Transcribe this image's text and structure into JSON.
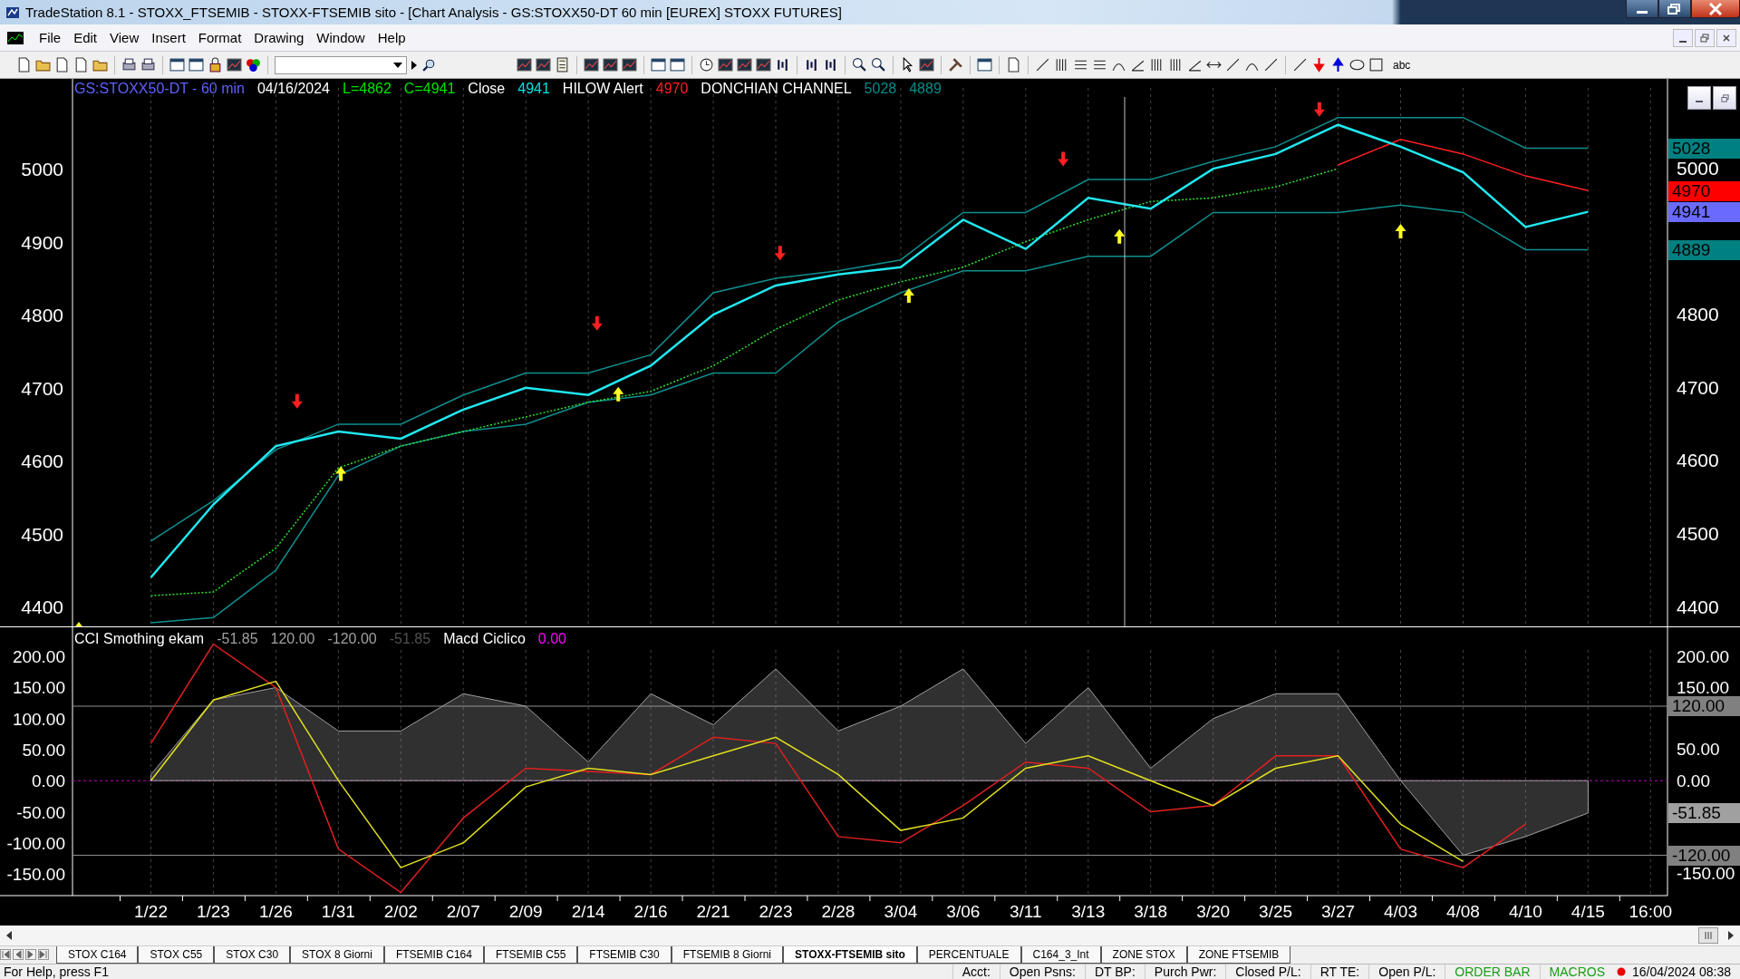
{
  "window": {
    "title": "TradeStation 8.1 - STOXX_FTSEMIB - STOXX-FTSEMIB sito - [Chart Analysis - GS:STOXX50-DT  60 min  [EUREX] STOXX FUTURES]"
  },
  "menu": [
    "File",
    "Edit",
    "View",
    "Insert",
    "Format",
    "Drawing",
    "Window",
    "Help"
  ],
  "toolbar": {
    "text_tool": "abc"
  },
  "price_panel": {
    "legend": [
      {
        "text": "GS:STOXX50-DT - 60 min",
        "color": "#6060ff"
      },
      {
        "text": "04/16/2024",
        "color": "#ffffff"
      },
      {
        "text": "L=4862",
        "color": "#00e000"
      },
      {
        "text": "C=4941",
        "color": "#00e000"
      },
      {
        "text": "Close",
        "color": "#ffffff"
      },
      {
        "text": "4941",
        "color": "#00e0e0"
      },
      {
        "text": "HILOW Alert",
        "color": "#ffffff"
      },
      {
        "text": "4970",
        "color": "#ff2020"
      },
      {
        "text": "DONCHIAN CHANNEL",
        "color": "#ffffff"
      },
      {
        "text": "5028",
        "color": "#008c8c"
      },
      {
        "text": "4889",
        "color": "#008c8c"
      }
    ],
    "chart_data": {
      "type": "line",
      "grid": true,
      "series": [
        {
          "color": "#0f8f8f",
          "values": [
            4490,
            4545,
            4615,
            4650,
            4650,
            4690,
            4720,
            4720,
            4745,
            4830,
            4850,
            4860,
            4875,
            4940,
            4940,
            4985,
            4985,
            5010,
            5030,
            5070,
            5070,
            5070,
            5028,
            5028,
            null
          ]
        },
        {
          "color": "#0f8f8f",
          "values": [
            4378,
            4385,
            4450,
            4580,
            4620,
            4640,
            4650,
            4680,
            4690,
            4720,
            4720,
            4790,
            4830,
            4860,
            4860,
            4880,
            4880,
            4940,
            4940,
            4940,
            4950,
            4940,
            4889,
            4889,
            null
          ]
        },
        {
          "color": "#30e030",
          "line_style": "dotted",
          "values": [
            4415,
            4420,
            4480,
            4590,
            4620,
            4640,
            4660,
            4680,
            4695,
            4730,
            4780,
            4820,
            4845,
            4865,
            4900,
            4930,
            4955,
            4960,
            4975,
            5000,
            null,
            null,
            null,
            null,
            null
          ]
        },
        {
          "color": "#ff2020",
          "values": [
            null,
            null,
            null,
            null,
            null,
            null,
            null,
            null,
            null,
            null,
            null,
            null,
            null,
            null,
            null,
            null,
            null,
            null,
            null,
            5005,
            5040,
            5020,
            4990,
            4970,
            null
          ]
        },
        {
          "color": "#20e8f0",
          "values": [
            4440,
            4540,
            4620,
            4640,
            4630,
            4670,
            4700,
            4690,
            4730,
            4800,
            4840,
            4855,
            4865,
            4930,
            4890,
            4960,
            4945,
            5000,
            5020,
            5060,
            5030,
            4995,
            4920,
            4941,
            null
          ]
        }
      ],
      "ylim": [
        4373,
        5123
      ],
      "yticks": [
        4400,
        4500,
        4600,
        4700,
        4800,
        4900,
        5000
      ]
    },
    "right_axis_labels": [
      "5000",
      "4800",
      "4700",
      "4600",
      "4500",
      "4400"
    ],
    "price_tags": [
      {
        "text": "5028",
        "color": "#008080"
      },
      {
        "text": "4970",
        "color": "#ff0000"
      },
      {
        "text": "4941",
        "color": "#6a6aff"
      },
      {
        "text": "4889",
        "color": "#008080"
      }
    ]
  },
  "oscillator_panel": {
    "legend": [
      {
        "text": "CCI Smothing ekam",
        "color": "#ffffff"
      },
      {
        "text": "-51.85",
        "color": "#a0a0a0"
      },
      {
        "text": "120.00",
        "color": "#a0a0a0"
      },
      {
        "text": "-120.00",
        "color": "#a0a0a0"
      },
      {
        "text": "-51.85",
        "color": "#505050"
      },
      {
        "text": "Macd Ciclico",
        "color": "#ffffff"
      },
      {
        "text": "0.00",
        "color": "#ff00ff"
      }
    ],
    "chart_data": {
      "type": "line",
      "grid": true,
      "categories": [
        "1/22",
        "1/23",
        "1/26",
        "1/31",
        "2/02",
        "2/07",
        "2/09",
        "2/14",
        "2/16",
        "2/21",
        "2/23",
        "2/28",
        "3/04",
        "3/06",
        "3/11",
        "3/13",
        "3/18",
        "3/20",
        "3/25",
        "3/27",
        "4/03",
        "4/08",
        "4/10",
        "4/15",
        "16:00"
      ],
      "series": [
        {
          "color": "#a0a0a0",
          "type": "area",
          "values": [
            10,
            130,
            150,
            80,
            80,
            140,
            120,
            30,
            140,
            90,
            180,
            80,
            120,
            180,
            60,
            150,
            20,
            100,
            140,
            140,
            0,
            -120,
            -90,
            -52,
            null
          ]
        },
        {
          "color": "#e02020",
          "values": [
            60,
            220,
            150,
            -110,
            -180,
            -60,
            20,
            15,
            10,
            70,
            60,
            -90,
            -100,
            -40,
            30,
            20,
            -50,
            -40,
            40,
            40,
            -110,
            -140,
            -70,
            null,
            null
          ]
        },
        {
          "color": "#e0e020",
          "values": [
            0,
            130,
            160,
            0,
            -140,
            -100,
            -10,
            20,
            10,
            40,
            70,
            10,
            -80,
            -60,
            20,
            40,
            0,
            -40,
            20,
            40,
            -70,
            -130,
            null,
            null,
            null
          ]
        }
      ],
      "ylim": [
        -185,
        247
      ],
      "yticks": [
        {
          "value": -150,
          "label": "-150.00"
        },
        {
          "value": -100,
          "label": "-100.00"
        },
        {
          "value": -50,
          "label": "-50.00"
        },
        {
          "value": 0,
          "label": "0.00"
        },
        {
          "value": 50,
          "label": "50.00"
        },
        {
          "value": 100,
          "label": "100.00"
        },
        {
          "value": 150,
          "label": "150.00"
        },
        {
          "value": 200,
          "label": "200.00"
        }
      ],
      "ref_lines": [
        {
          "axis": "y",
          "value": 120,
          "label": "120.00",
          "color": "#909090"
        },
        {
          "axis": "y",
          "value": -120,
          "label": "-120.00",
          "color": "#909090"
        },
        {
          "axis": "y",
          "value": 0,
          "color": "#c000c0"
        }
      ]
    },
    "right_axis_labels": [
      "200.00",
      "150.00",
      "50.00",
      "0.00",
      "-150.00"
    ],
    "value_tags": [
      {
        "text": "-51.85",
        "color": "#a0a0a0"
      }
    ]
  },
  "sheet_tabs": [
    {
      "label": "STOX C164",
      "selected": false
    },
    {
      "label": "STOX C55",
      "selected": false
    },
    {
      "label": "STOX  C30",
      "selected": false
    },
    {
      "label": "STOX  8 Giorni",
      "selected": false
    },
    {
      "label": "FTSEMIB C164",
      "selected": false
    },
    {
      "label": "FTSEMIB C55",
      "selected": false
    },
    {
      "label": "FTSEMIB C30",
      "selected": false
    },
    {
      "label": "FTSEMIB  8 Giorni",
      "selected": false
    },
    {
      "label": "STOXX-FTSEMIB sito",
      "selected": true
    },
    {
      "label": "PERCENTUALE",
      "selected": false
    },
    {
      "label": "C164_3_Int",
      "selected": false
    },
    {
      "label": "ZONE STOX",
      "selected": false
    },
    {
      "label": "ZONE FTSEMIB",
      "selected": false
    }
  ],
  "status_bar": {
    "help": "For Help, press F1",
    "fields": [
      "Acct:",
      "Open Psns:",
      "DT BP:",
      "Purch Pwr:",
      "Closed P/L:",
      "RT TE:",
      "Open P/L:"
    ],
    "order_bar": "ORDER BAR",
    "macros": "MACROS",
    "datetime": "16/04/2024 08:38"
  }
}
